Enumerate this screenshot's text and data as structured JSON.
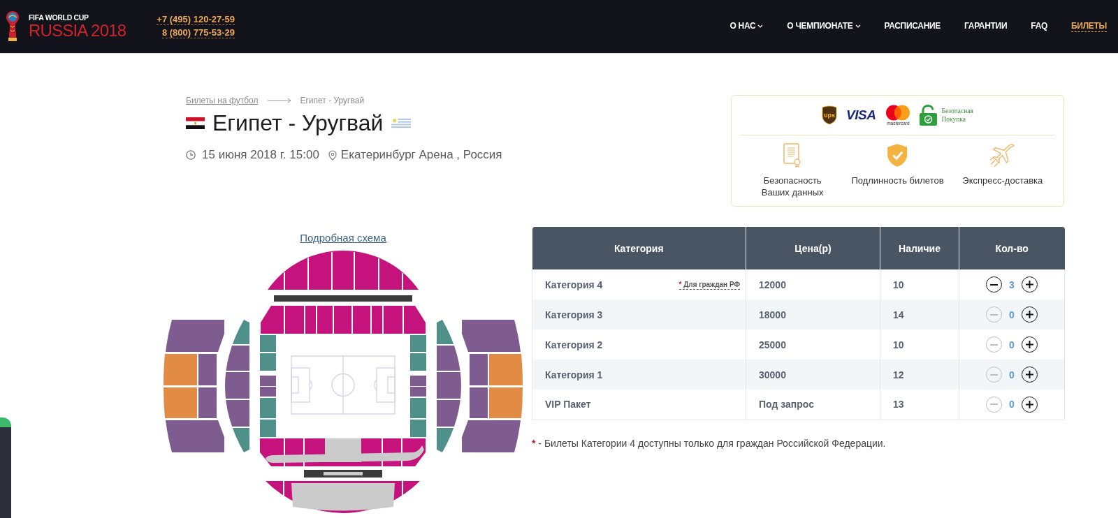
{
  "header": {
    "logo": {
      "top": "FIFA WORLD CUP",
      "main": "RUSSIA 2018"
    },
    "phones": [
      "+7 (495) 120-27-59",
      "8 (800) 775-53-29"
    ],
    "nav": [
      {
        "label": "О НАС",
        "has_menu": true,
        "selected": false
      },
      {
        "label": "О ЧЕМПИОНАТЕ",
        "has_menu": true,
        "selected": false
      },
      {
        "label": "РАСПИСАНИЕ",
        "has_menu": false,
        "selected": false
      },
      {
        "label": "ГАРАНТИИ",
        "has_menu": false,
        "selected": false
      },
      {
        "label": "FAQ",
        "has_menu": false,
        "selected": false
      },
      {
        "label": "БИЛЕТЫ",
        "has_menu": false,
        "selected": true
      }
    ]
  },
  "match": {
    "breadcrumb": {
      "parent": "Билеты на футбол",
      "current": "Египет - Уругвай"
    },
    "title": "Египет - Уругвай",
    "date": "15 июня 2018 г. 15:00",
    "venue": "Екатеринбург Арена , Россия"
  },
  "trust_panel": {
    "logos": [
      {
        "kind": "ups",
        "text": "ups"
      },
      {
        "kind": "visa",
        "text": "VISA"
      },
      {
        "kind": "mastercard",
        "text": "mastercard"
      },
      {
        "kind": "secure",
        "text": "Безопасная Покупка"
      }
    ],
    "features": [
      {
        "kind": "certificate",
        "label": "Безопасность Ваших данных"
      },
      {
        "kind": "shield",
        "label": "Подлинность билетов"
      },
      {
        "kind": "plane",
        "label": "Экспресс-доставка"
      }
    ]
  },
  "seating_map": {
    "link": "Подробная схема"
  },
  "tickets": {
    "columns": [
      "Категория",
      "Цена(р)",
      "Наличие",
      "Кол-во"
    ],
    "rows": [
      {
        "category": "Категория 4",
        "note": {
          "mark": "*",
          "text": "Для граждан РФ"
        },
        "price": "12000",
        "available": "10",
        "quantity": "3",
        "decrease_disabled": false
      },
      {
        "category": "Категория 3",
        "price": "18000",
        "available": "14",
        "quantity": "0",
        "decrease_disabled": true
      },
      {
        "category": "Категория 2",
        "price": "25000",
        "available": "10",
        "quantity": "0",
        "decrease_disabled": true
      },
      {
        "category": "Категория 1",
        "price": "30000",
        "available": "12",
        "quantity": "0",
        "decrease_disabled": true
      },
      {
        "category": "VIP Пакет",
        "price": "Под запрос",
        "available": "13",
        "quantity": "0",
        "decrease_disabled": true
      }
    ],
    "footnote": {
      "mark": "*",
      "text": "- Билеты Категории 4 доступны только для граждан Российской Федерации."
    }
  }
}
